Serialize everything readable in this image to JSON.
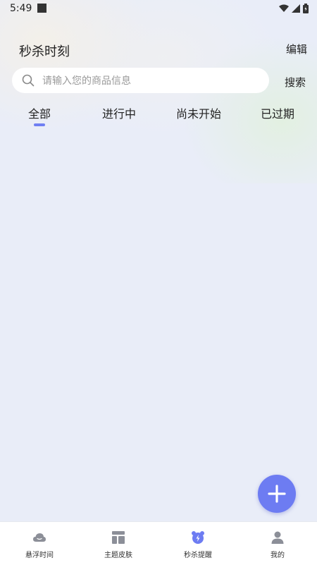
{
  "status_bar": {
    "time": "5:49"
  },
  "header": {
    "title": "秒杀时刻",
    "edit_label": "编辑"
  },
  "search": {
    "placeholder": "请输入您的商品信息",
    "value": "",
    "button_label": "搜索"
  },
  "tabs": [
    {
      "label": "全部",
      "active": true
    },
    {
      "label": "进行中",
      "active": false
    },
    {
      "label": "尚未开始",
      "active": false
    },
    {
      "label": "已过期",
      "active": false
    }
  ],
  "fab": {
    "icon": "plus-icon"
  },
  "bottom_nav": [
    {
      "label": "悬浮时间",
      "icon": "cloud-icon",
      "active": false
    },
    {
      "label": "主题皮肤",
      "icon": "layout-icon",
      "active": false
    },
    {
      "label": "秒杀提醒",
      "icon": "alarm-clock-icon",
      "active": true
    },
    {
      "label": "我的",
      "icon": "user-icon",
      "active": false
    }
  ],
  "colors": {
    "accent": "#6d7cf2",
    "background": "#e9edf8",
    "icon_gray": "#8c8f98"
  }
}
